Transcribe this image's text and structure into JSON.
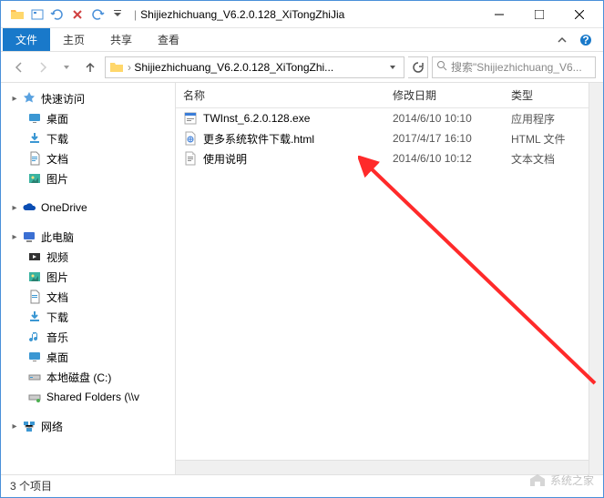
{
  "window": {
    "title": "Shijiezhichuang_V6.2.0.128_XiTongZhiJia"
  },
  "ribbon": {
    "tabs": {
      "file": "文件",
      "home": "主页",
      "share": "共享",
      "view": "查看"
    }
  },
  "address": {
    "breadcrumb_text": "Shijiezhichuang_V6.2.0.128_XiTongZhi...",
    "search_placeholder": "搜索\"Shijiezhichuang_V6..."
  },
  "columns": {
    "name": "名称",
    "date": "修改日期",
    "type": "类型"
  },
  "sidebar": {
    "quick_access": "快速访问",
    "desktop": "桌面",
    "downloads": "下载",
    "documents": "文档",
    "pictures": "图片",
    "onedrive": "OneDrive",
    "this_pc": "此电脑",
    "videos": "视频",
    "pictures2": "图片",
    "documents2": "文档",
    "downloads2": "下载",
    "music": "音乐",
    "desktop2": "桌面",
    "local_c": "本地磁盘 (C:)",
    "shared": "Shared Folders (\\\\v",
    "network": "网络"
  },
  "files": [
    {
      "name": "TWInst_6.2.0.128.exe",
      "date": "2014/6/10 10:10",
      "type": "应用程序",
      "icon": "exe"
    },
    {
      "name": "更多系统软件下载.html",
      "date": "2017/4/17 16:10",
      "type": "HTML 文件",
      "icon": "html"
    },
    {
      "name": "使用说明",
      "date": "2014/6/10 10:12",
      "type": "文本文档",
      "icon": "txt"
    }
  ],
  "status": {
    "item_count": "3 个项目"
  },
  "watermark": "系统之家"
}
